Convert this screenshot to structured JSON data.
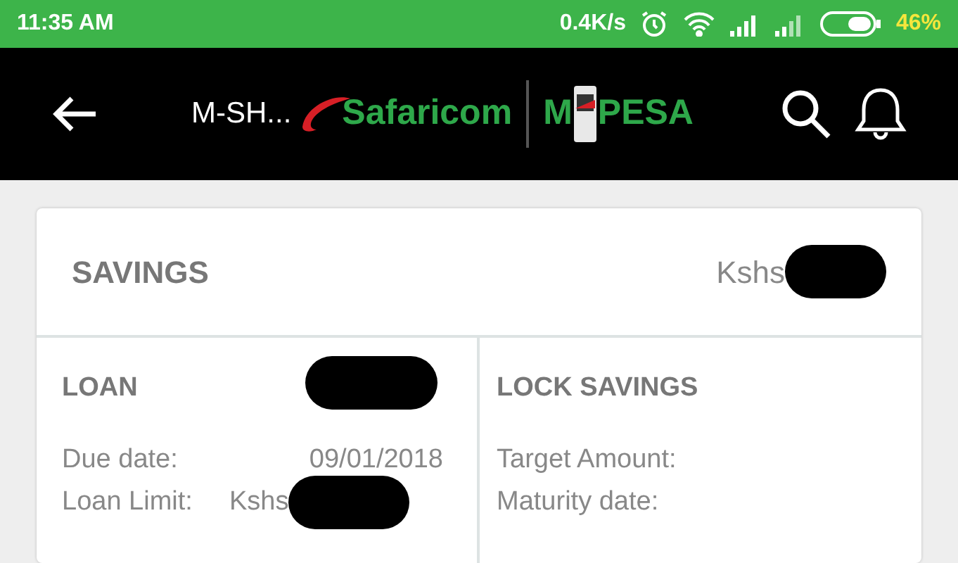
{
  "status_bar": {
    "time": "11:35 AM",
    "speed": "0.4K/s",
    "battery": "46%"
  },
  "header": {
    "title": "M-SH...",
    "brand": "Safaricom",
    "service_left": "M",
    "service_right": "PESA"
  },
  "savings": {
    "title": "SAVINGS",
    "amount_prefix": "Kshs",
    "amount_redacted": true
  },
  "loan": {
    "title": "LOAN",
    "title_redacted": true,
    "rows": [
      {
        "label": "Due date:",
        "value": "09/01/2018",
        "redacted": false
      },
      {
        "label": "Loan Limit:",
        "value": "Kshs",
        "redacted": true
      }
    ]
  },
  "lock_savings": {
    "title": "LOCK SAVINGS",
    "rows": [
      {
        "label": "Target Amount:"
      },
      {
        "label": "Maturity date:"
      }
    ]
  }
}
